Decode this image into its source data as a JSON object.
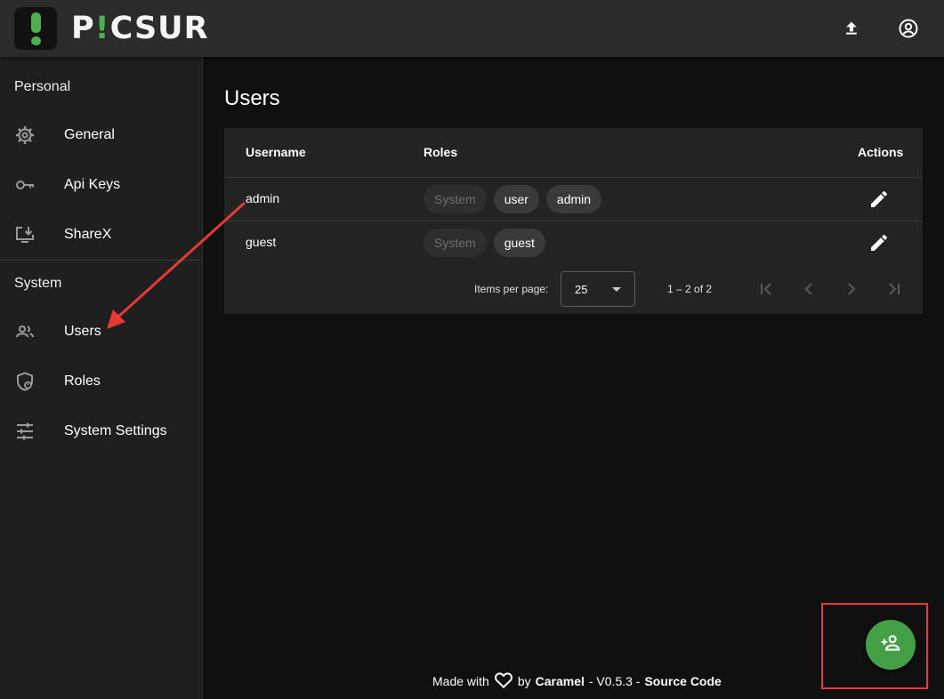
{
  "app": {
    "brand_pre": "P",
    "brand_mark": "!",
    "brand_post": "CSUR"
  },
  "topbar": {
    "upload_icon": "upload-icon",
    "account_icon": "account-circle-icon"
  },
  "sidebar": {
    "personal_header": "Personal",
    "personal_items": [
      {
        "label": "General",
        "icon": "gear-icon"
      },
      {
        "label": "Api Keys",
        "icon": "key-icon"
      },
      {
        "label": "ShareX",
        "icon": "download-screen-icon"
      }
    ],
    "system_header": "System",
    "system_items": [
      {
        "label": "Users",
        "icon": "users-icon"
      },
      {
        "label": "Roles",
        "icon": "shield-user-icon"
      },
      {
        "label": "System Settings",
        "icon": "sliders-icon"
      }
    ]
  },
  "main": {
    "title": "Users",
    "table": {
      "columns": [
        "Username",
        "Roles",
        "Actions"
      ],
      "rows": [
        {
          "username": "admin",
          "roles": [
            "System",
            "user",
            "admin"
          ]
        },
        {
          "username": "guest",
          "roles": [
            "System",
            "guest"
          ]
        }
      ]
    },
    "paginator": {
      "items_per_page_label": "Items per page:",
      "page_size": "25",
      "range": "1 – 2 of 2"
    }
  },
  "footer": {
    "made_with": "Made with",
    "by": "by",
    "author": "Caramel",
    "version": "- V0.5.3 -",
    "source": "Source Code"
  },
  "colors": {
    "accent": "#4caf50",
    "fab": "#43a047",
    "annotation": "#e53935"
  }
}
